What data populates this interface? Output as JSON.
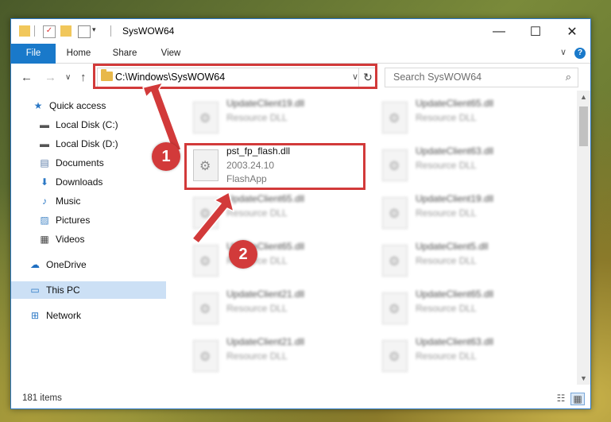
{
  "window": {
    "title": "SysWOW64",
    "minimize": "—",
    "maximize": "☐",
    "close": "✕"
  },
  "ribbon": {
    "tabs": [
      "File",
      "Home",
      "Share",
      "View"
    ],
    "expand": "∨",
    "help": "?"
  },
  "nav": {
    "back": "←",
    "forward": "→",
    "recent": "∨",
    "up": "↑",
    "address": "C:\\Windows\\SysWOW64",
    "dropdown": "∨",
    "refresh": "↻",
    "search_placeholder": "Search SysWOW64",
    "search_icon": "⌕"
  },
  "sidebar": {
    "items": [
      {
        "label": "Quick access",
        "icon": "★",
        "pinned": false
      },
      {
        "label": "Local Disk (C:)",
        "icon": "▬",
        "pinned": false
      },
      {
        "label": "Local Disk (D:)",
        "icon": "▬",
        "pinned": false
      },
      {
        "label": "Documents",
        "icon": "▤",
        "pinned": true
      },
      {
        "label": "Downloads",
        "icon": "⬇",
        "pinned": true
      },
      {
        "label": "Music",
        "icon": "♪",
        "pinned": true
      },
      {
        "label": "Pictures",
        "icon": "▨",
        "pinned": true
      },
      {
        "label": "Videos",
        "icon": "▦",
        "pinned": true
      },
      {
        "label": "OneDrive",
        "icon": "☁",
        "pinned": false
      },
      {
        "label": "This PC",
        "icon": "▭",
        "pinned": false,
        "selected": true
      },
      {
        "label": "Network",
        "icon": "⊞",
        "pinned": false
      }
    ],
    "pin_icon": "📌"
  },
  "files": {
    "left": [
      {
        "name": "UpdateClient19.dll",
        "type": "Resource DLL"
      },
      {
        "name": "pst_fp_flash.dll",
        "version": "2003.24.10",
        "type": "FlashApp"
      },
      {
        "name": "UpdateClient65.dll",
        "type": "Resource DLL"
      },
      {
        "name": "UpdateClient65.dll",
        "type": "Resource DLL"
      },
      {
        "name": "UpdateClient21.dll",
        "type": "Resource DLL"
      },
      {
        "name": "UpdateClient21.dll",
        "type": "Resource DLL"
      }
    ],
    "right": [
      {
        "name": "UpdateClient65.dll",
        "type": "Resource DLL"
      },
      {
        "name": "UpdateClient63.dll",
        "type": "Resource DLL"
      },
      {
        "name": "UpdateClient19.dll",
        "type": "Resource DLL"
      },
      {
        "name": "UpdateClient5.dll",
        "type": "Resource DLL"
      },
      {
        "name": "UpdateClient65.dll",
        "type": "Resource DLL"
      },
      {
        "name": "UpdateClient63.dll",
        "type": "Resource DLL"
      }
    ]
  },
  "status": {
    "count": "181 items"
  },
  "annotations": {
    "step1": "1",
    "step2": "2",
    "color": "#d23a3a"
  }
}
